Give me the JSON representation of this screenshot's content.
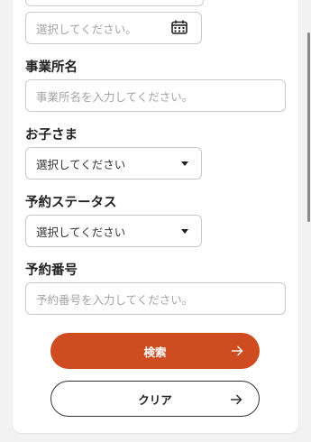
{
  "form": {
    "date_field": {
      "placeholder": "選択してください。",
      "icon": "calendar-icon"
    },
    "office_name": {
      "label": "事業所名",
      "placeholder": "事業所名を入力してください。"
    },
    "child": {
      "label": "お子さま",
      "value": "選択してください",
      "icon": "caret-down-icon"
    },
    "reservation_status": {
      "label": "予約ステータス",
      "value": "選択してください",
      "icon": "caret-down-icon"
    },
    "reservation_number": {
      "label": "予約番号",
      "placeholder": "予約番号を入力してください。"
    }
  },
  "buttons": {
    "search_label": "検索",
    "clear_label": "クリア",
    "arrow_icon": "arrow-right-icon"
  },
  "colors": {
    "accent": "#cf4c21",
    "border": "#c9c9c9",
    "placeholder": "#a3a3a3"
  }
}
